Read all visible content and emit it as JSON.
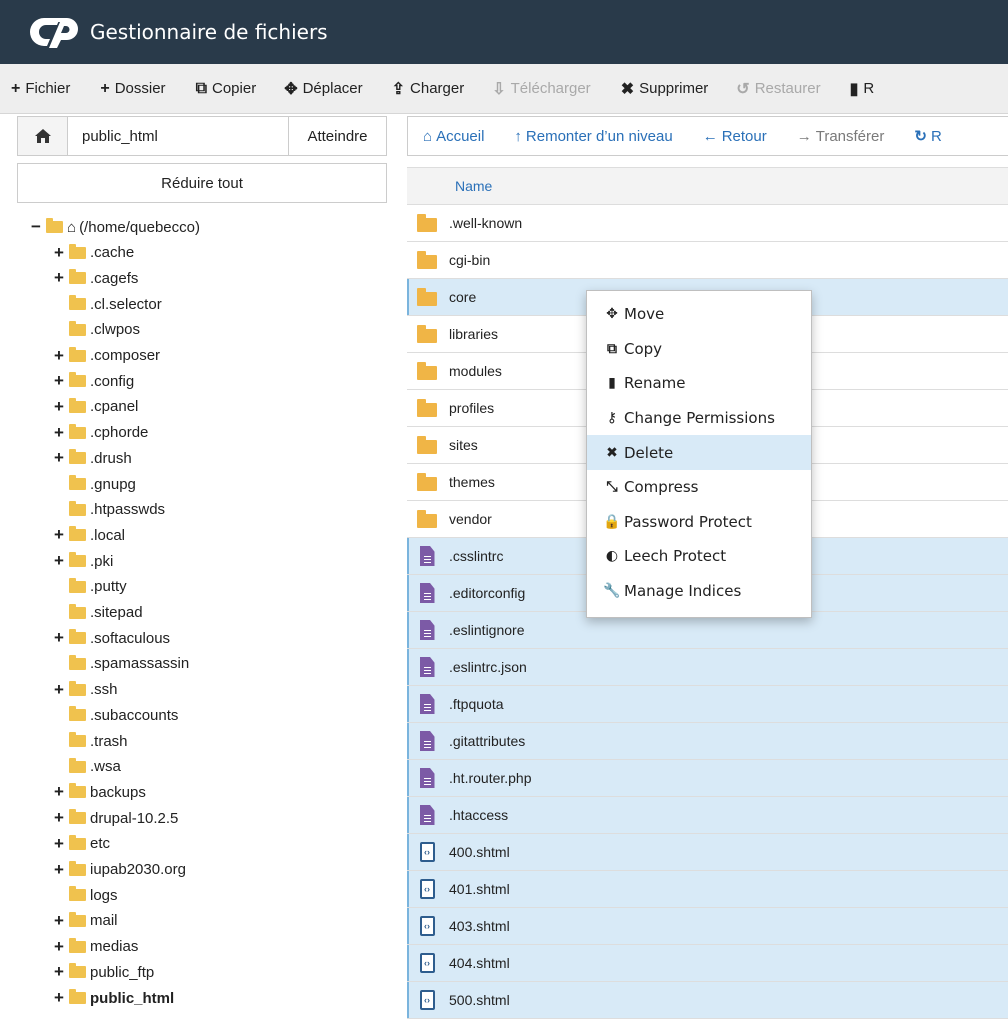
{
  "header": {
    "title": "Gestionnaire de fichiers"
  },
  "toolbar": {
    "items": [
      {
        "label": "Fichier",
        "icon": "+"
      },
      {
        "label": "Dossier",
        "icon": "+"
      },
      {
        "label": "Copier",
        "icon": "⧉"
      },
      {
        "label": "Déplacer",
        "icon": "✥"
      },
      {
        "label": "Charger",
        "icon": "⇪"
      },
      {
        "label": "Télécharger",
        "icon": "⇩"
      },
      {
        "label": "Supprimer",
        "icon": "✖"
      },
      {
        "label": "Restaurer",
        "icon": "↺"
      },
      {
        "label": "R",
        "icon": "▮"
      }
    ]
  },
  "left": {
    "path_value": "public_html",
    "go_label": "Atteindre",
    "collapse_label": "Réduire tout",
    "tree": [
      {
        "label": "(/home/quebecco)",
        "toggle": "−",
        "root": true
      },
      {
        "label": ".cache",
        "toggle": "+"
      },
      {
        "label": ".cagefs",
        "toggle": "+"
      },
      {
        "label": ".cl.selector",
        "toggle": ""
      },
      {
        "label": ".clwpos",
        "toggle": ""
      },
      {
        "label": ".composer",
        "toggle": "+"
      },
      {
        "label": ".config",
        "toggle": "+"
      },
      {
        "label": ".cpanel",
        "toggle": "+"
      },
      {
        "label": ".cphorde",
        "toggle": "+"
      },
      {
        "label": ".drush",
        "toggle": "+"
      },
      {
        "label": ".gnupg",
        "toggle": ""
      },
      {
        "label": ".htpasswds",
        "toggle": ""
      },
      {
        "label": ".local",
        "toggle": "+"
      },
      {
        "label": ".pki",
        "toggle": "+"
      },
      {
        "label": ".putty",
        "toggle": ""
      },
      {
        "label": ".sitepad",
        "toggle": ""
      },
      {
        "label": ".softaculous",
        "toggle": "+"
      },
      {
        "label": ".spamassassin",
        "toggle": ""
      },
      {
        "label": ".ssh",
        "toggle": "+"
      },
      {
        "label": ".subaccounts",
        "toggle": ""
      },
      {
        "label": ".trash",
        "toggle": ""
      },
      {
        "label": ".wsa",
        "toggle": ""
      },
      {
        "label": "backups",
        "toggle": "+"
      },
      {
        "label": "drupal-10.2.5",
        "toggle": "+"
      },
      {
        "label": "etc",
        "toggle": "+"
      },
      {
        "label": "iupab2030.org",
        "toggle": "+"
      },
      {
        "label": "logs",
        "toggle": ""
      },
      {
        "label": "mail",
        "toggle": "+"
      },
      {
        "label": "medias",
        "toggle": "+"
      },
      {
        "label": "public_ftp",
        "toggle": "+"
      },
      {
        "label": "public_html",
        "toggle": "+",
        "bold": true
      }
    ]
  },
  "nav": {
    "items": [
      {
        "label": "Accueil",
        "icon": "⌂"
      },
      {
        "label": "Remonter d’un niveau",
        "icon": "↑"
      },
      {
        "label": "Retour",
        "icon": "←"
      },
      {
        "label": "Transférer",
        "icon": "→"
      },
      {
        "label": "R",
        "icon": "↻"
      }
    ]
  },
  "table": {
    "header_name": "Name",
    "rows": [
      {
        "name": ".well-known",
        "type": "folder",
        "selected": false
      },
      {
        "name": "cgi-bin",
        "type": "folder",
        "selected": false
      },
      {
        "name": "core",
        "type": "folder",
        "selected": true
      },
      {
        "name": "libraries",
        "type": "folder",
        "selected": false
      },
      {
        "name": "modules",
        "type": "folder",
        "selected": false
      },
      {
        "name": "profiles",
        "type": "folder",
        "selected": false
      },
      {
        "name": "sites",
        "type": "folder",
        "selected": false
      },
      {
        "name": "themes",
        "type": "folder",
        "selected": false
      },
      {
        "name": "vendor",
        "type": "folder",
        "selected": false
      },
      {
        "name": ".csslintrc",
        "type": "file",
        "selected": true
      },
      {
        "name": ".editorconfig",
        "type": "file",
        "selected": true
      },
      {
        "name": ".eslintignore",
        "type": "file",
        "selected": true
      },
      {
        "name": ".eslintrc.json",
        "type": "file",
        "selected": true
      },
      {
        "name": ".ftpquota",
        "type": "file",
        "selected": true
      },
      {
        "name": ".gitattributes",
        "type": "file",
        "selected": true
      },
      {
        "name": ".ht.router.php",
        "type": "file",
        "selected": true
      },
      {
        "name": ".htaccess",
        "type": "file",
        "selected": true
      },
      {
        "name": "400.shtml",
        "type": "code",
        "selected": true
      },
      {
        "name": "401.shtml",
        "type": "code",
        "selected": true
      },
      {
        "name": "403.shtml",
        "type": "code",
        "selected": true
      },
      {
        "name": "404.shtml",
        "type": "code",
        "selected": true
      },
      {
        "name": "500.shtml",
        "type": "code",
        "selected": true
      }
    ]
  },
  "context_menu": {
    "items": [
      {
        "label": "Move",
        "icon": "✥"
      },
      {
        "label": "Copy",
        "icon": "⧉"
      },
      {
        "label": "Rename",
        "icon": "▮"
      },
      {
        "label": "Change Permissions",
        "icon": "⚷"
      },
      {
        "label": "Delete",
        "icon": "✖"
      },
      {
        "label": "Compress",
        "icon": "⤡"
      },
      {
        "label": "Password Protect",
        "icon": "🔒"
      },
      {
        "label": "Leech Protect",
        "icon": "◐"
      },
      {
        "label": "Manage Indices",
        "icon": "🔧"
      }
    ]
  }
}
